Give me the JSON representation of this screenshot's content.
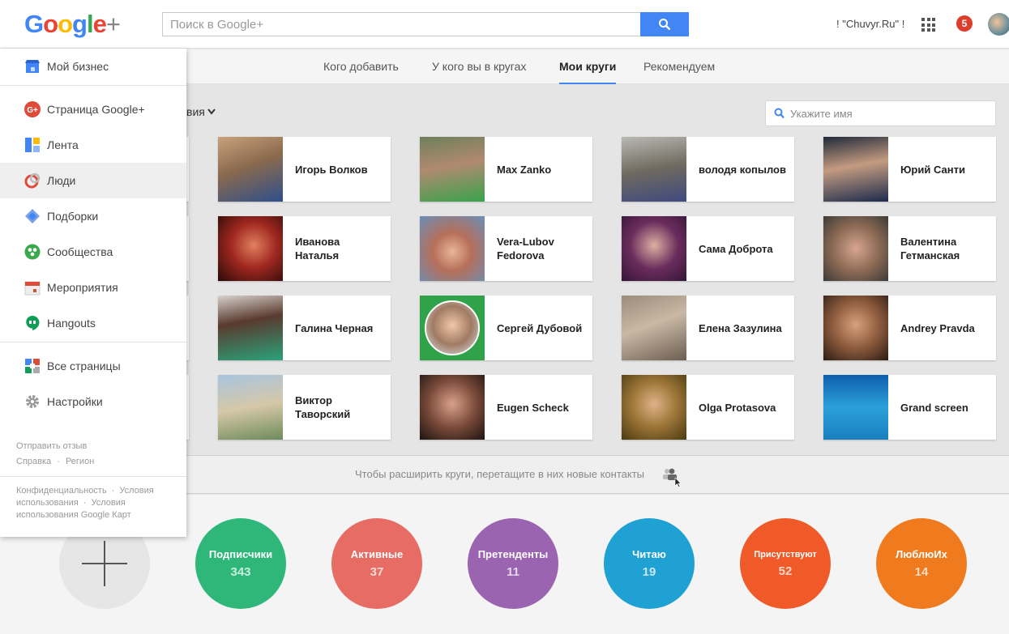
{
  "header": {
    "search_placeholder": "Поиск в Google+",
    "user_name": "! \"Chuvyr.Ru\" !",
    "notifications": "5"
  },
  "tabs": [
    {
      "label": "Кого добавить"
    },
    {
      "label": "У кого вы в кругах"
    },
    {
      "label": "Мои круги"
    },
    {
      "label": "Рекомендуем"
    }
  ],
  "sort_label": "вия",
  "name_search_placeholder": "Укажите имя",
  "contacts": [
    {
      "name": "Игорь Волков"
    },
    {
      "name": "Max Zanko"
    },
    {
      "name": "володя копылов"
    },
    {
      "name": "Юрий Санти"
    },
    {
      "name": "Иванова Наталья"
    },
    {
      "name": "Vera-Lubov Fedorova"
    },
    {
      "name": "Сама Доброта"
    },
    {
      "name": "Валентина Гетманская"
    },
    {
      "name": "Галина Черная"
    },
    {
      "name": "Сергей Дубовой"
    },
    {
      "name": "Елена Зазулина"
    },
    {
      "name": "Andrey Pravda"
    },
    {
      "name": "Виктор Таворский"
    },
    {
      "name": "Eugen Scheck"
    },
    {
      "name": "Olga Protasova"
    },
    {
      "name": "Grand screen"
    }
  ],
  "drop_hint": "Чтобы расширить круги, перетащите в них новые контакты",
  "circles": [
    {
      "name": "Подписчики",
      "count": "343",
      "color": "#2fb77a"
    },
    {
      "name": "Активные",
      "count": "37",
      "color": "#e66c64"
    },
    {
      "name": "Претенденты",
      "count": "11",
      "color": "#9a64b0"
    },
    {
      "name": "Читаю",
      "count": "19",
      "color": "#1fa2d3"
    },
    {
      "name": "Присутствуют",
      "count": "52",
      "color": "#f05a28"
    },
    {
      "name": "ЛюблюИх",
      "count": "14",
      "color": "#f07a1e"
    }
  ],
  "drawer": {
    "business": "Мой бизнес",
    "items": [
      {
        "label": "Страница Google+"
      },
      {
        "label": "Лента"
      },
      {
        "label": "Люди"
      },
      {
        "label": "Подборки"
      },
      {
        "label": "Сообщества"
      },
      {
        "label": "Мероприятия"
      },
      {
        "label": "Hangouts"
      }
    ],
    "all_pages": "Все страницы",
    "settings": "Настройки",
    "feedback": "Отправить отзыв",
    "help": "Справка",
    "region": "Регион",
    "privacy": "Конфиденциальность",
    "terms": "Условия использования",
    "maps_terms": "Условия использования Google Карт"
  },
  "colors": {
    "accent": "#4285f4",
    "badge": "#dd3e2c"
  }
}
